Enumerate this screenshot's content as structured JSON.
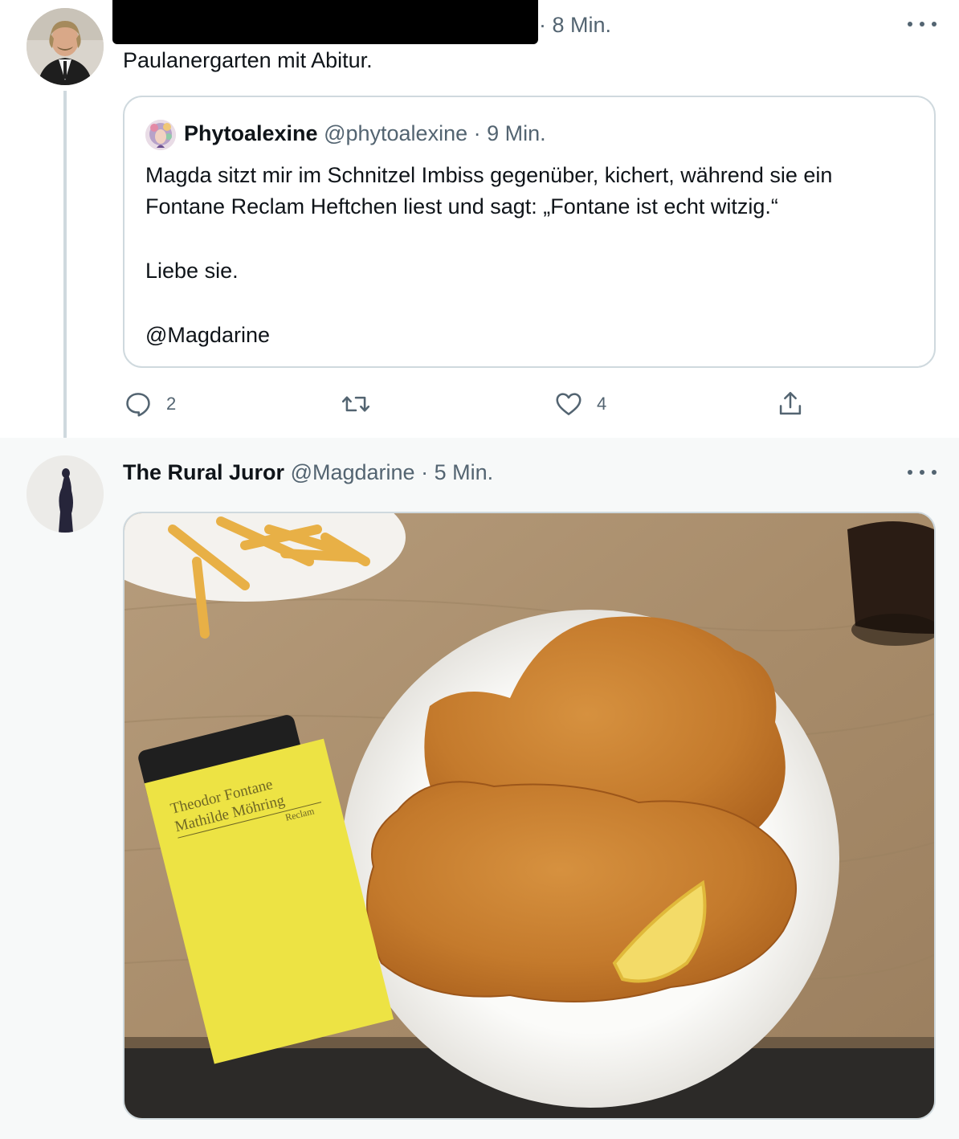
{
  "tweet1": {
    "meta": "· 8 Min.",
    "text": "Paulanergarten mit Abitur.",
    "quote": {
      "name": "Phytoalexine",
      "handle": "@phytoalexine",
      "time": "· 9 Min.",
      "lines": [
        "Magda sitzt mir im Schnitzel Imbiss gegenüber, kichert, während sie ein",
        "Fontane Reclam Heftchen liest und sagt: „Fontane ist echt witzig.“",
        "Liebe sie.",
        "@Magdarine"
      ]
    },
    "actions": {
      "reply_count": "2",
      "like_count": "4"
    }
  },
  "tweet2": {
    "name": "The Rural Juror",
    "handle": "@Magdarine",
    "time": "· 5 Min.",
    "image": {
      "book_author": "Theodor Fontane",
      "book_title": "Mathilde Möhring",
      "book_publisher": "Reclam"
    }
  },
  "colors": {
    "text": "#0f1419",
    "secondary": "#536471",
    "border": "#cfd9de",
    "highlight_bg": "#f7f9f9"
  }
}
